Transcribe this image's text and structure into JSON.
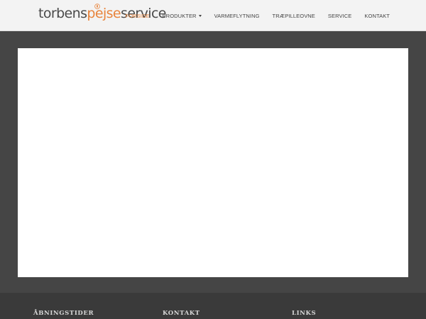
{
  "brand": {
    "logo_part_1": "torbens",
    "logo_part_2": "pejse",
    "logo_part_3": "service",
    "accent_color": "#e8843c",
    "text_color": "#4a4a4a"
  },
  "nav": {
    "items": [
      {
        "label": "FORSIDE",
        "active": true
      },
      {
        "label": "PRODUKTER",
        "dropdown": true
      },
      {
        "label": "VARMEFLYTNING"
      },
      {
        "label": "TRÆPILLEOVNE"
      },
      {
        "label": "SERVICE"
      },
      {
        "label": "KONTAKT"
      }
    ]
  },
  "footer": {
    "headings": [
      "ÅBNINGSTIDER",
      "KONTAKT",
      "LINKS"
    ]
  }
}
